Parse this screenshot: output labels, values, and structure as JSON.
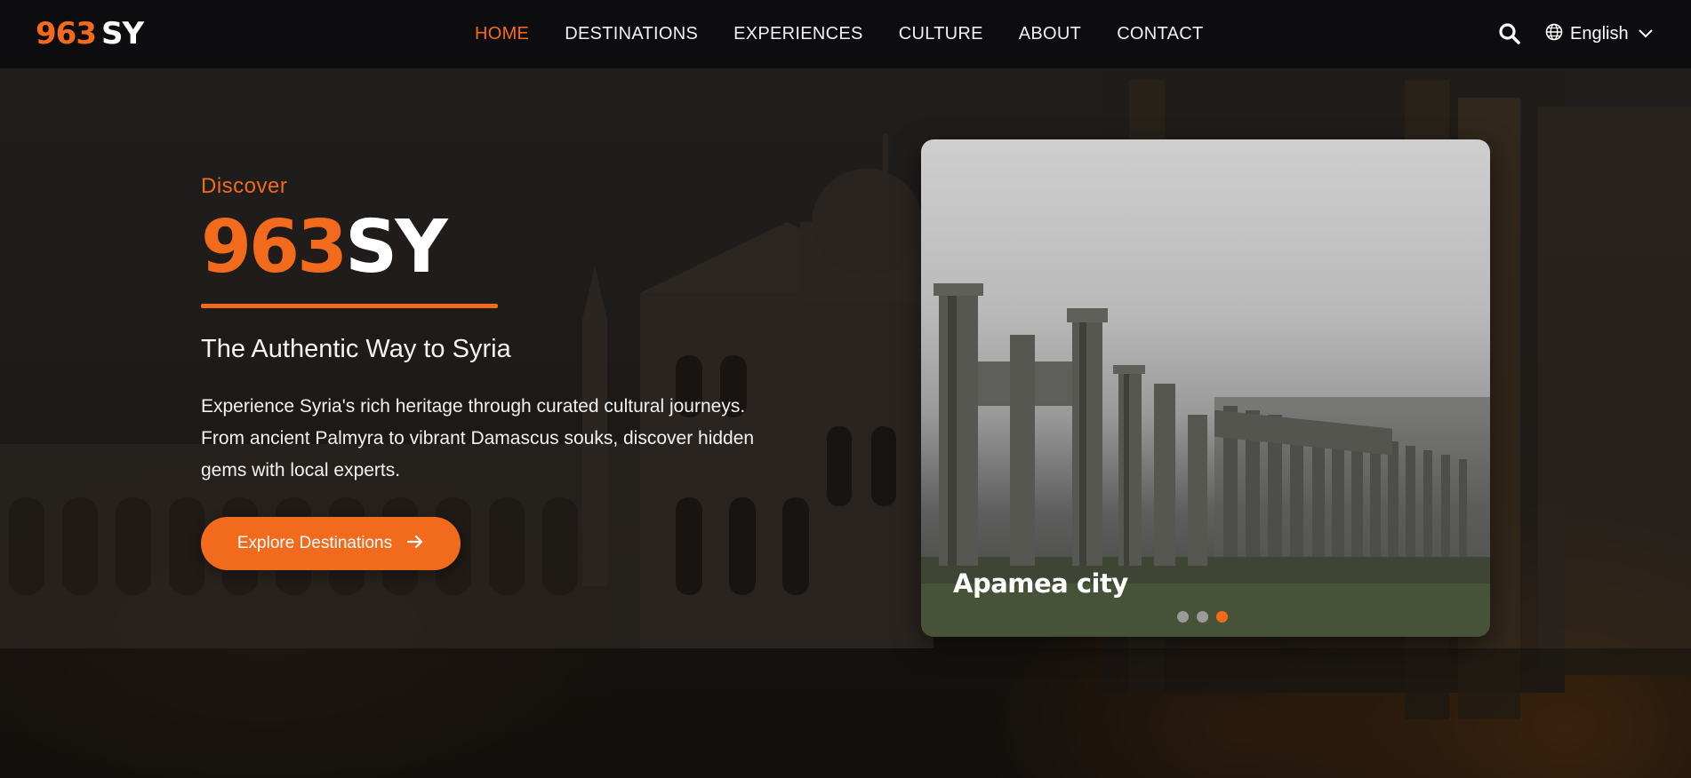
{
  "brand": {
    "num": "963",
    "sy": "SY"
  },
  "nav": {
    "items": [
      {
        "label": "HOME",
        "active": true
      },
      {
        "label": "DESTINATIONS",
        "active": false
      },
      {
        "label": "EXPERIENCES",
        "active": false
      },
      {
        "label": "CULTURE",
        "active": false
      },
      {
        "label": "ABOUT",
        "active": false
      },
      {
        "label": "CONTACT",
        "active": false
      }
    ],
    "search_icon": "search-icon",
    "language": {
      "icon": "globe-icon",
      "label": "English",
      "chevron": "chevron-down-icon"
    }
  },
  "hero": {
    "eyebrow": "Discover",
    "title_num": "963",
    "title_sy": "SY",
    "tagline": "The Authentic Way to Syria",
    "description": "Experience Syria's rich heritage through curated cultural journeys. From ancient Palmyra to vibrant Damascus souks, discover hidden gems with local experts.",
    "cta_label": "Explore Destinations",
    "cta_icon": "arrow-right-icon"
  },
  "slider": {
    "caption": "Apamea city",
    "dots": [
      {
        "active": false
      },
      {
        "active": false
      },
      {
        "active": true
      }
    ],
    "current": 3,
    "total": 3
  },
  "colors": {
    "accent": "#f26b1d",
    "nav_bg": "#0a0a0c",
    "text": "#ffffff"
  }
}
